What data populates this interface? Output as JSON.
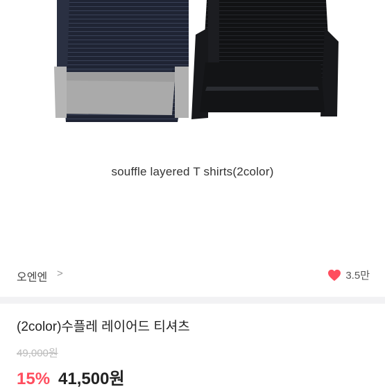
{
  "product_image": {
    "caption": "souffle layered T shirts(2color)",
    "colors": {
      "navy": "#1f2434",
      "grey": "#a9a9a9",
      "black": "#111214"
    }
  },
  "seller": {
    "name": "오엔엔",
    "arrow": ">",
    "like_icon": "heart-icon",
    "like_color": "#ff4d5e",
    "like_count": "3.5만"
  },
  "product": {
    "title": "(2color)수플레 레이어드 티셔츠",
    "original_price": "49,000원",
    "discount": "15%",
    "sale_price": "41,500원"
  }
}
